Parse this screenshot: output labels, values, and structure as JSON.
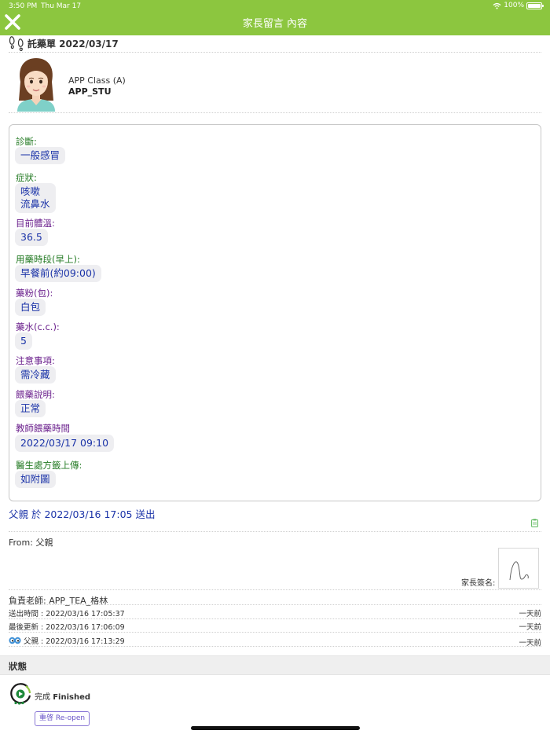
{
  "status_bar": {
    "time": "3:50 PM",
    "date": "Thu Mar 17",
    "battery": "100%"
  },
  "header": {
    "title": "家長留言 內容",
    "close_icon": "close-icon"
  },
  "form": {
    "title": "託藥單 2022/03/17"
  },
  "student": {
    "class": "APP Class (A)",
    "name": "APP_STU"
  },
  "colors": {
    "header": "#8cc63f",
    "label_green": "#237a23",
    "label_purple": "#6a1f8c",
    "value_blue": "#1b33a8"
  },
  "fields": [
    {
      "label": "診斷:",
      "value": "一般感冒"
    },
    {
      "label": "症狀:",
      "value": "咳嗽",
      "value2": "流鼻水"
    },
    {
      "label": "目前體溫:",
      "value": "36.5"
    },
    {
      "label": "用藥時段(早上):",
      "value": "早餐前(約09:00)"
    },
    {
      "label": "藥粉(包):",
      "value": "白包"
    },
    {
      "label": "藥水(c.c.):",
      "value": "5"
    },
    {
      "label": "注意事項:",
      "value": "需冷藏"
    },
    {
      "label": "餵藥說明:",
      "value": "正常"
    },
    {
      "label": "教師餵藥時間",
      "value": "2022/03/17 09:10"
    },
    {
      "label": "醫生處方籤上傳:",
      "value": "如附圖"
    }
  ],
  "sent_line": "父親 於 2022/03/16 17:05 送出",
  "from": "From: 父親",
  "signature_label": "家長簽名:",
  "teacher": "負責老師: APP_TEA_格林",
  "log": [
    {
      "text": "送出時間 : 2022/03/16 17:05:37",
      "ago": "一天前"
    },
    {
      "text": "最後更新 : 2022/03/16 17:06:09",
      "ago": "一天前"
    },
    {
      "text": "父親 : 2022/03/16 17:13:29",
      "ago": "一天前"
    }
  ],
  "status": {
    "header": "狀態",
    "state": "完成",
    "state_en": "Finished",
    "reopen": "重啓 Re-open"
  }
}
